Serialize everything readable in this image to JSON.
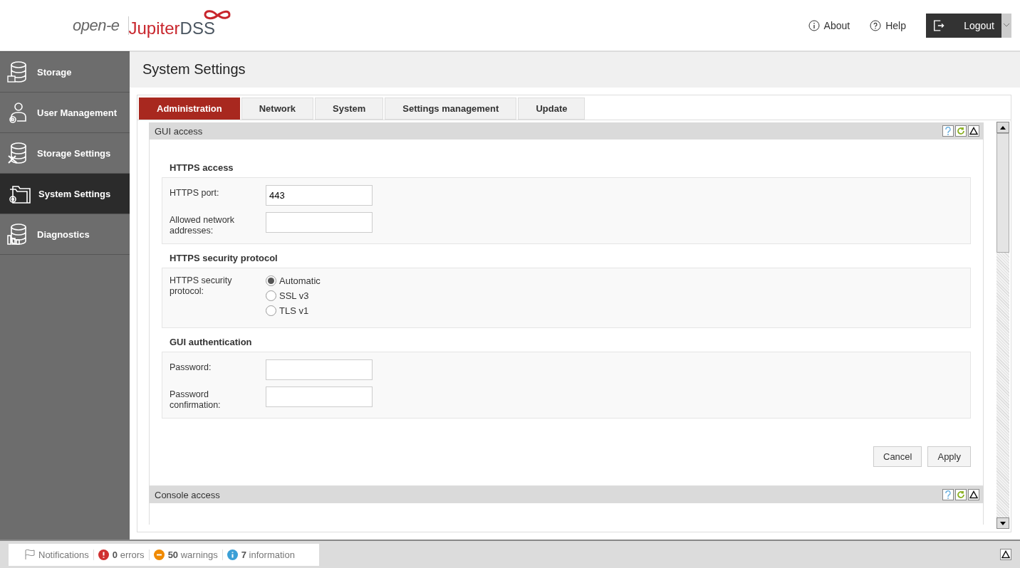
{
  "header": {
    "brand": "open-e",
    "product": "Jupiter",
    "product_suffix": "DSS",
    "links": [
      {
        "label": "About",
        "kind": "info"
      },
      {
        "label": "Help",
        "kind": "help"
      }
    ],
    "logout": "Logout"
  },
  "sidebar": {
    "items": [
      {
        "label": "Storage",
        "kind": "storage",
        "selected": false
      },
      {
        "label": "User Management",
        "kind": "user",
        "selected": false
      },
      {
        "label": "Storage Settings",
        "kind": "tools",
        "selected": false
      },
      {
        "label": "System Settings",
        "kind": "folder",
        "selected": true
      },
      {
        "label": "Diagnostics",
        "kind": "chart",
        "selected": false
      }
    ]
  },
  "page_title": "System Settings",
  "tabs": [
    {
      "label": "Administration",
      "selected": true
    },
    {
      "label": "Network",
      "selected": false
    },
    {
      "label": "System",
      "selected": false
    },
    {
      "label": "Settings management",
      "selected": false
    },
    {
      "label": "Update",
      "selected": false
    }
  ],
  "panels": [
    {
      "title": "GUI access",
      "expanded": true,
      "sections": [
        {
          "title": "HTTPS access",
          "fields": [
            {
              "kind": "text",
              "label": "HTTPS port:",
              "value": "443"
            },
            {
              "kind": "text",
              "label": "Allowed network addresses:"
            }
          ]
        },
        {
          "title": "HTTPS security protocol",
          "fields": [
            {
              "kind": "radio",
              "label": "HTTPS security protocol:",
              "options": [
                {
                  "label": "Automatic",
                  "selected": true
                },
                {
                  "label": "SSL v3",
                  "selected": false
                },
                {
                  "label": "TLS v1",
                  "selected": false
                }
              ]
            }
          ]
        },
        {
          "title": "GUI authentication",
          "fields": [
            {
              "kind": "password",
              "label": "Password:"
            },
            {
              "kind": "password",
              "label": "Password confirmation:"
            }
          ]
        }
      ],
      "buttons": [
        "Cancel",
        "Apply"
      ]
    },
    {
      "title": "Console access",
      "expanded": false
    }
  ],
  "status_bar": {
    "notifications": "Notifications",
    "items": [
      {
        "kind": "error",
        "count": "0",
        "label": "errors",
        "color": "#d03030"
      },
      {
        "kind": "warning",
        "count": "50",
        "label": "warnings",
        "color": "#f08a00"
      },
      {
        "kind": "info",
        "count": "7",
        "label": "information",
        "color": "#3a9fd6"
      }
    ]
  }
}
